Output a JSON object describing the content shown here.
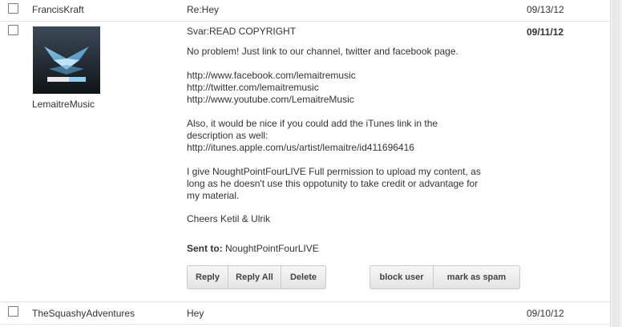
{
  "messages": [
    {
      "sender": "FrancisKraft",
      "subject": "Re:Hey",
      "date": "09/13/12"
    },
    {
      "sender": "LemaitreMusic",
      "subject": "Svar:READ COPYRIGHT",
      "date": "09/11/12"
    },
    {
      "sender": "TheSquashyAdventures",
      "subject": "Hey",
      "date": "09/10/12"
    }
  ],
  "open_message": {
    "avatar_text": "LEMAITRE",
    "body": [
      "No problem! Just link to our channel, twitter and facebook page.",
      "http://www.facebook.com/lemaitremusic",
      "http://twitter.com/lemaitremusic",
      "http://www.youtube.com/LemaitreMusic",
      "Also, it would be nice if you could add the iTunes link in the",
      "description as well:",
      "http://itunes.apple.com/us/artist/lemaitre/id411696416",
      "I give NoughtPointFourLIVE Full permission to upload my content, as",
      "long as he doesn't use this oppotunity to take credit or advantage for",
      "my material.",
      "Cheers Ketil & Ulrik"
    ],
    "sent_to_label": "Sent to:",
    "sent_to_value": "NoughtPointFourLIVE"
  },
  "actions": {
    "reply": "Reply",
    "reply_all": "Reply All",
    "delete": "Delete",
    "block_user": "block user",
    "mark_as_spam": "mark as spam"
  }
}
